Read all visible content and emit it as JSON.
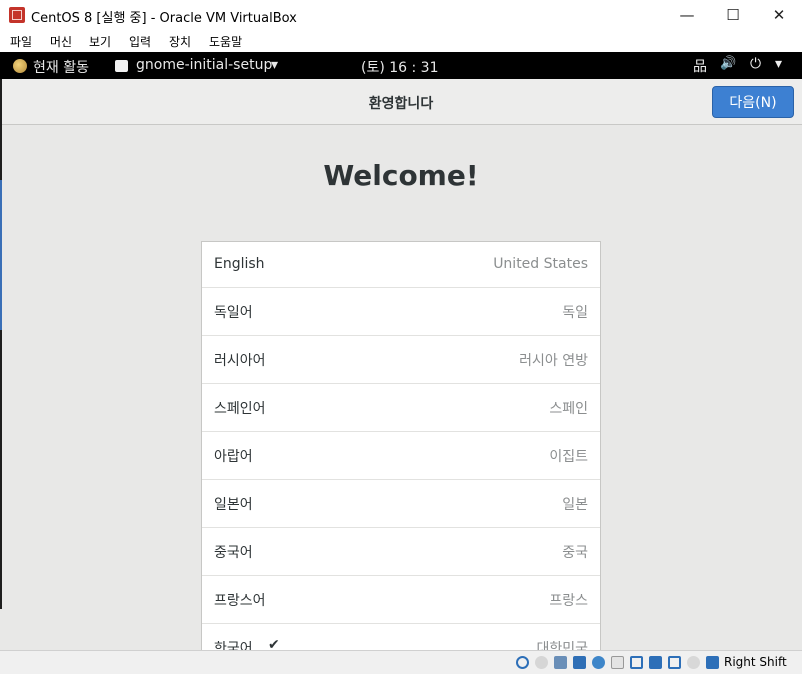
{
  "window": {
    "title": "CentOS 8 [실행 중] - Oracle VM VirtualBox",
    "minimize": "—",
    "maximize": "☐",
    "close": "✕"
  },
  "menubar": {
    "items": [
      "파일",
      "머신",
      "보기",
      "입력",
      "장치",
      "도움말"
    ]
  },
  "topbar": {
    "activities": "현재 활동",
    "app_name": "gnome-initial-setup",
    "app_arrow": "▾",
    "clock": "(토) 16 : 31",
    "network": "品",
    "volume": "🔊",
    "power": "⏻",
    "menu_arrow": "▾"
  },
  "setup": {
    "header_title": "환영합니다",
    "next_label": "다음(N)",
    "welcome": "Welcome!",
    "languages": [
      {
        "name": "English",
        "region": "United States",
        "selected": false
      },
      {
        "name": "독일어",
        "region": "독일",
        "selected": false
      },
      {
        "name": "러시아어",
        "region": "러시아 연방",
        "selected": false
      },
      {
        "name": "스페인어",
        "region": "스페인",
        "selected": false
      },
      {
        "name": "아랍어",
        "region": "이집트",
        "selected": false
      },
      {
        "name": "일본어",
        "region": "일본",
        "selected": false
      },
      {
        "name": "중국어",
        "region": "중국",
        "selected": false
      },
      {
        "name": "프랑스어",
        "region": "프랑스",
        "selected": false
      },
      {
        "name": "한국어",
        "region": "대한민국",
        "selected": true
      }
    ],
    "check_mark": "✔"
  },
  "statusbar": {
    "host_key": "Right Shift",
    "icons": [
      "hdd-icon",
      "optical-icon",
      "audio-icon",
      "network-icon",
      "usb-icon",
      "shared-folder-icon",
      "display-icon",
      "recording-icon",
      "cpu-icon",
      "mouse-icon",
      "keyboard-icon"
    ]
  }
}
